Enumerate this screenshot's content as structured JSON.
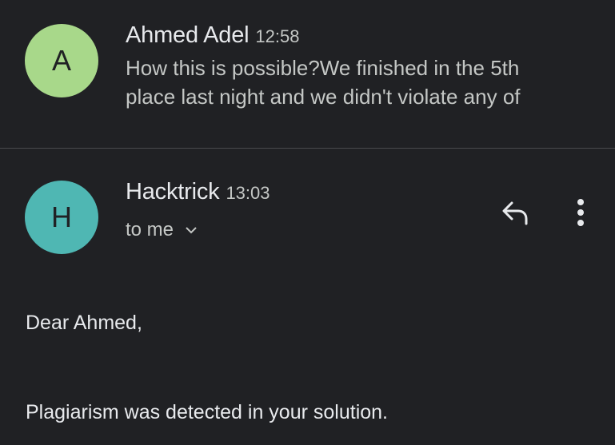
{
  "messages": [
    {
      "avatar_letter": "A",
      "avatar_color": "#a8d88a",
      "sender": "Ahmed Adel",
      "time": "12:58",
      "snippet_line1": "How this is possible?We finished in the 5th",
      "snippet_line2": "place last night and we didn't violate any of"
    },
    {
      "avatar_letter": "H",
      "avatar_color": "#4fb7b3",
      "sender": "Hacktrick",
      "time": "13:03",
      "recipients": "to me",
      "body": {
        "greeting": "Dear Ahmed,",
        "paragraph1": "Plagiarism was detected in your solution."
      }
    }
  ],
  "icons": {
    "reply": "reply-icon",
    "more": "more-vert-icon",
    "expand": "chevron-down-icon"
  }
}
